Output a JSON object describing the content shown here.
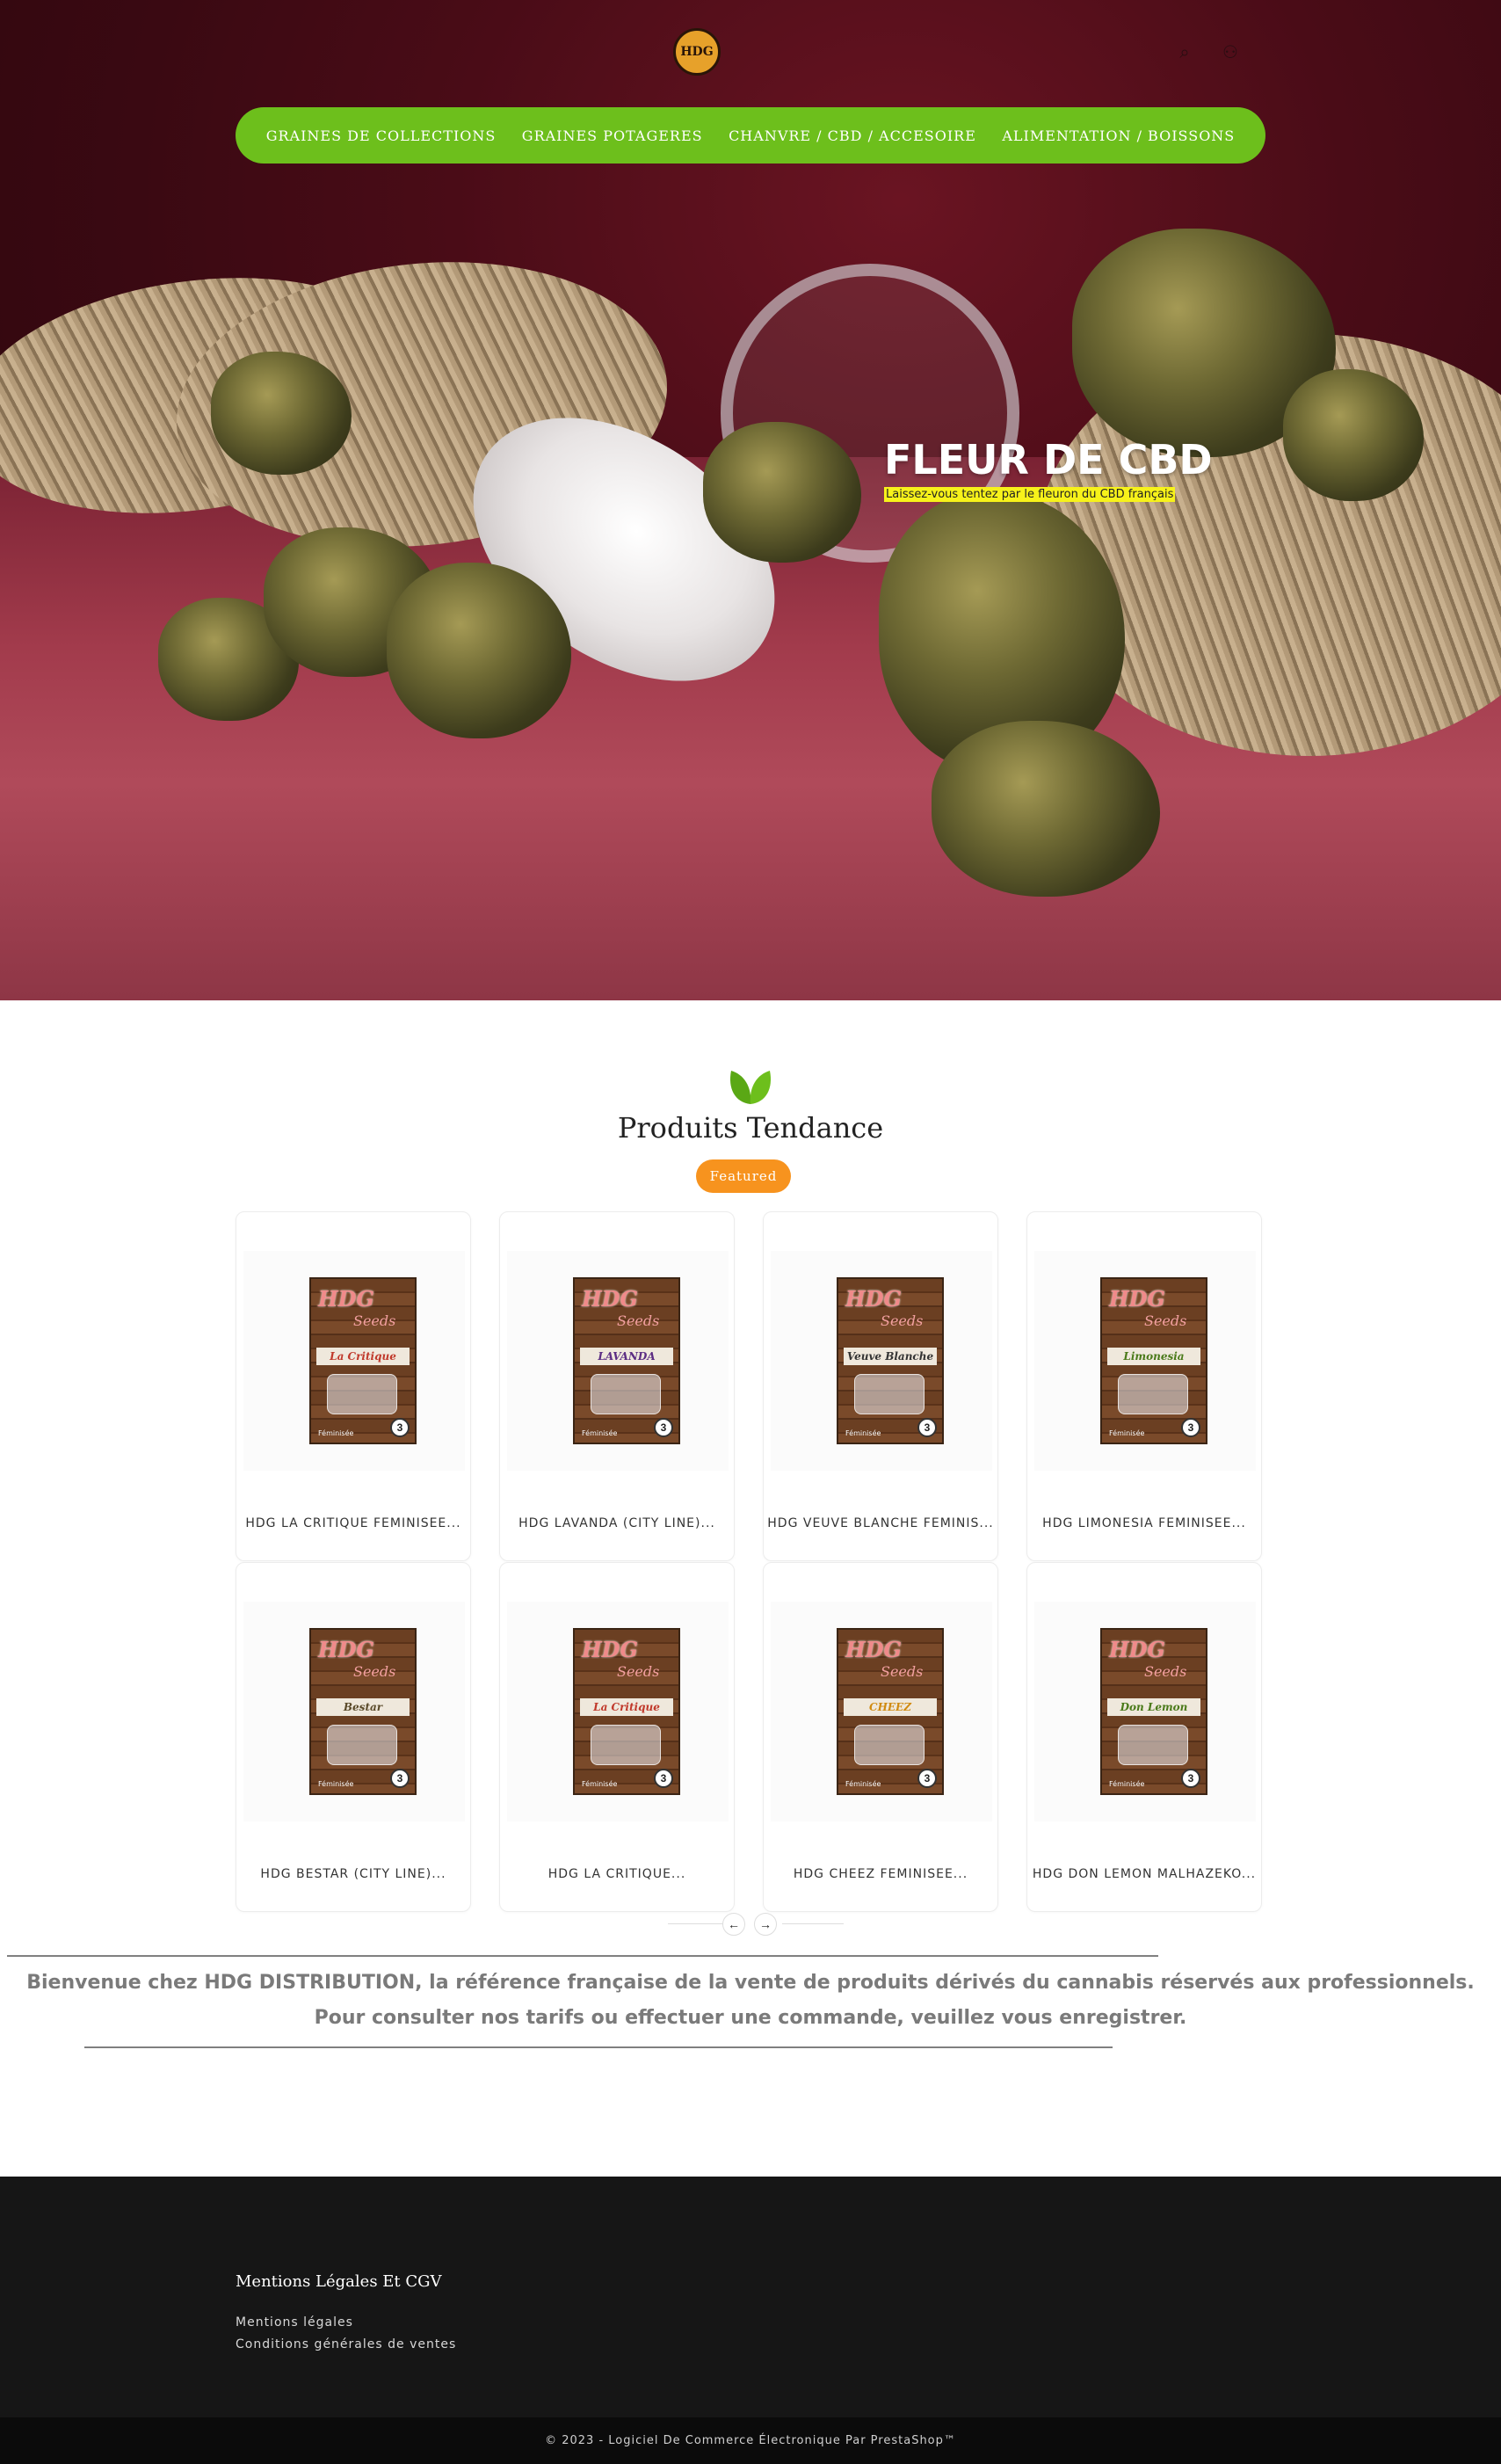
{
  "header": {
    "logo_text": "HDG",
    "search_icon": "search-icon",
    "account_icon": "user-icon"
  },
  "nav": {
    "items": [
      {
        "label": "GRAINES DE COLLECTIONS"
      },
      {
        "label": "GRAINES POTAGERES"
      },
      {
        "label": "CHANVRE / CBD / ACCESOIRE"
      },
      {
        "label": "ALIMENTATION / BOISSONS"
      }
    ],
    "color": "#6dbf1c"
  },
  "hero": {
    "title": "FLEUR DE CBD",
    "subtitle": "Laissez-vous tentez par le fleuron du CBD français"
  },
  "products_section": {
    "icon": "leaf-icon",
    "title": "Produits Tendance",
    "badge": "Featured",
    "badge_color": "#f7931e",
    "products": [
      {
        "name": "HDG LA CRITIQUE FEMINISEE...",
        "strain": "La Critique"
      },
      {
        "name": "HDG LAVANDA (CITY LINE)...",
        "strain": "LAVANDA"
      },
      {
        "name": "HDG VEUVE BLANCHE FEMINIS...",
        "strain": "Veuve Blanche"
      },
      {
        "name": "HDG LIMONESIA FEMINISEE...",
        "strain": "Limonesia"
      },
      {
        "name": "HDG BESTAR (CITY LINE)...",
        "strain": "Bestar"
      },
      {
        "name": "HDG LA CRITIQUE...",
        "strain": "La Critique"
      },
      {
        "name": "HDG CHEEZ FEMINISEE...",
        "strain": "CHEEZ"
      },
      {
        "name": "HDG DON LEMON MALHAZEKO...",
        "strain": "Don Lemon"
      }
    ],
    "prev_icon": "arrow-left-icon",
    "next_icon": "arrow-right-icon"
  },
  "welcome": {
    "line1": "Bienvenue chez HDG DISTRIBUTION, la référence française de la vente de produits dérivés du cannabis réservés aux professionnels.",
    "line2": "Pour consulter nos tarifs ou effectuer une commande, veuillez vous enregistrer.",
    "dashes_top": "___________________________________________________________________________________________________________________________________",
    "dashes_bottom": "_____________________________________________________________________________________________________________________"
  },
  "footer": {
    "heading": "Mentions Légales Et CGV",
    "links": [
      {
        "label": "Mentions légales"
      },
      {
        "label": "Conditions générales de ventes"
      }
    ],
    "copyright": "© 2023 - Logiciel De Commerce Électronique Par PrestaShop™"
  }
}
